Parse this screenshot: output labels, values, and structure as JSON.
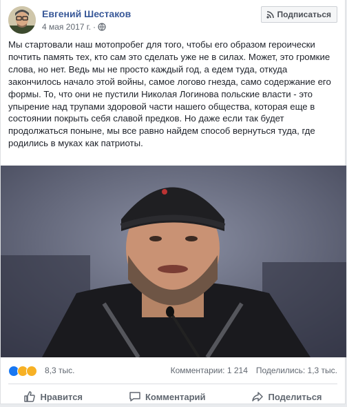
{
  "post": {
    "author": "Евгений Шестаков",
    "date": "4 мая 2017 г.",
    "subscribe_label": "Подписаться",
    "text": "Мы стартовали наш мотопробег для того, чтобы его образом героически почтить память тех, кто сам это сделать уже не в силах. Может, это громкие слова, но нет. Ведь мы не просто каждый год, а едем туда, откуда закончилось начало этой войны, самое логово гнезда, само содержание его формы. То, что они не пустили Николая Логинова польские власти - это упырение над трупами здоровой части нашего общества, которая еще в состоянии покрыть себя славой предков. Но даже если так будет продолжаться поныне, мы все равно найдем способ вернуться туда, где родились в муках как патриоты.",
    "reaction_icons": [
      "like-icon",
      "haha-icon",
      "wow-icon"
    ],
    "reaction_count": "8,3 тыс.",
    "comments_label": "Комментарии: 1 214",
    "shares_label": "Поделились: 1,3 тыс."
  },
  "actions": {
    "like": "Нравится",
    "comment": "Комментарий",
    "share": "Поделиться"
  },
  "colors": {
    "link": "#385898",
    "secondary_text": "#606770",
    "page_bg": "#e9ebee",
    "like_blue": "#1877f2",
    "reaction_yellow": "#f7b125"
  }
}
